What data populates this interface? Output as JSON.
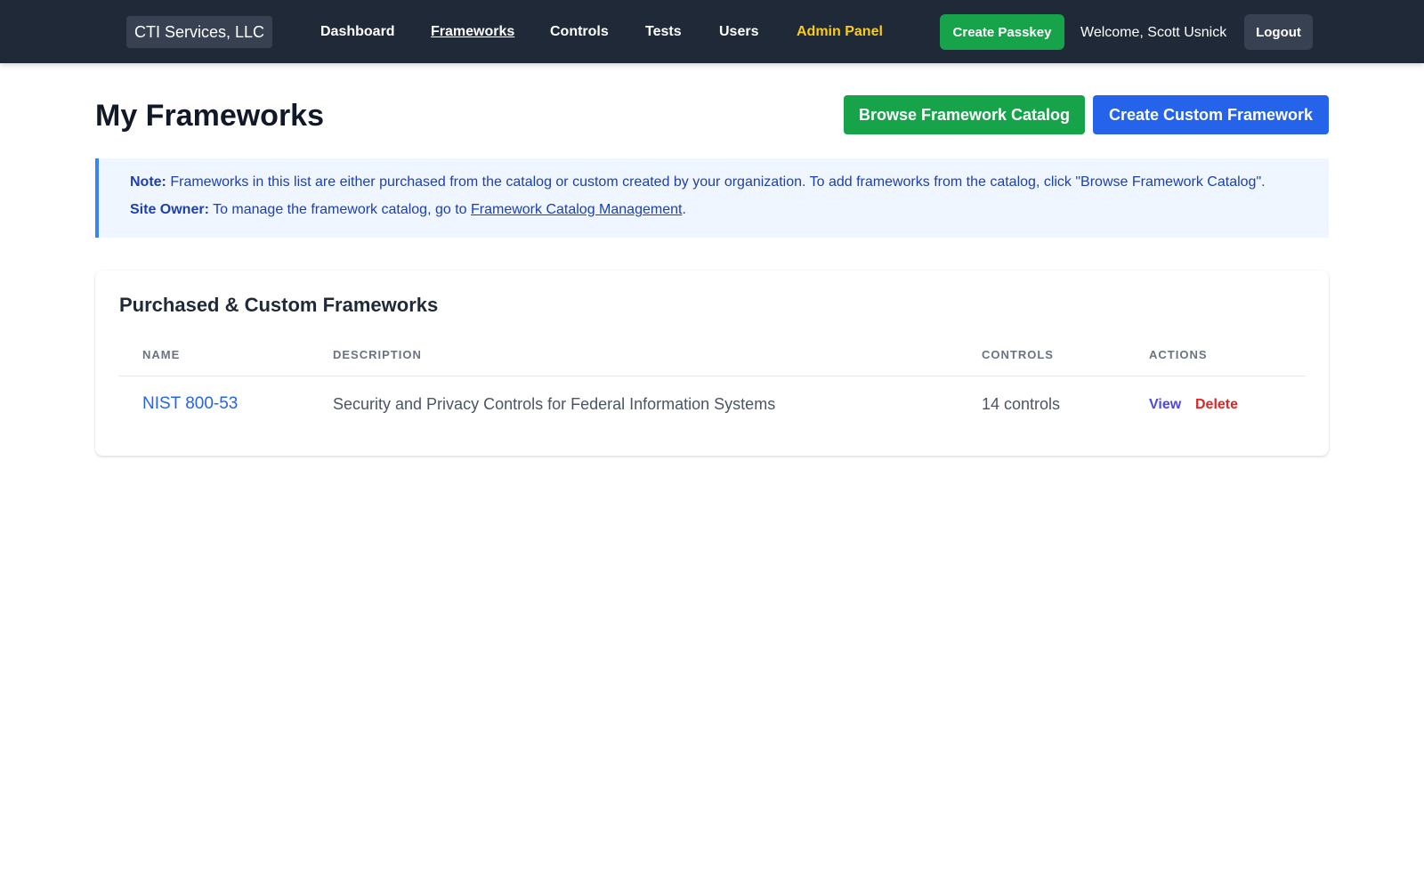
{
  "nav": {
    "brand": "CTI Services, LLC",
    "links": [
      {
        "label": "Dashboard",
        "active": false
      },
      {
        "label": "Frameworks",
        "active": true
      },
      {
        "label": "Controls",
        "active": false
      },
      {
        "label": "Tests",
        "active": false
      },
      {
        "label": "Users",
        "active": false
      },
      {
        "label": "Admin Panel",
        "active": false
      }
    ],
    "create_passkey_label": "Create Passkey",
    "welcome_text": "Welcome, Scott Usnick",
    "logout_label": "Logout"
  },
  "page": {
    "title": "My Frameworks",
    "browse_catalog_label": "Browse Framework Catalog",
    "create_custom_label": "Create Custom Framework"
  },
  "note": {
    "note_prefix": "Note:",
    "note_text": " Frameworks in this list are either purchased from the catalog or custom created by your organization. To add frameworks from the catalog, click \"Browse Framework Catalog\".",
    "owner_prefix": "Site Owner:",
    "owner_text": " To manage the framework catalog, go to ",
    "owner_link": "Framework Catalog Management",
    "owner_suffix": "."
  },
  "table": {
    "title": "Purchased & Custom Frameworks",
    "columns": [
      "Name",
      "Description",
      "Controls",
      "Actions"
    ],
    "rows": [
      {
        "name": "NIST 800-53",
        "description": "Security and Privacy Controls for Federal Information Systems",
        "controls": "14 controls",
        "actions": [
          "View",
          "Delete"
        ]
      }
    ]
  },
  "colors": {
    "nav_bg": "#1f2937",
    "success": "#16a34a",
    "primary": "#2563eb",
    "admin_link": "#facc15",
    "danger": "#dc2626"
  }
}
